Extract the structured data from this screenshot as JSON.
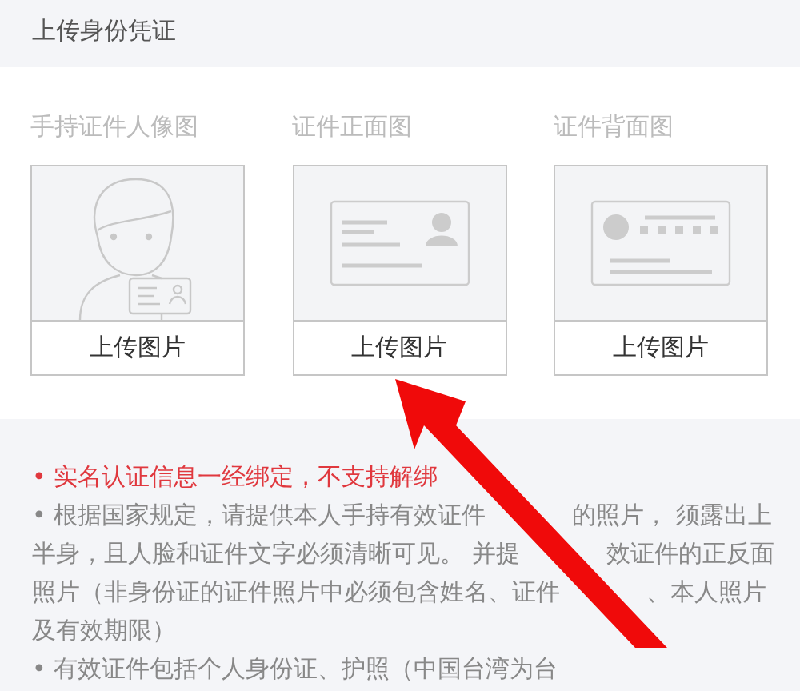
{
  "header": {
    "title": "上传身份凭证"
  },
  "uploads": [
    {
      "kind": "portrait",
      "label": "手持证件人像图",
      "button": "上传图片"
    },
    {
      "kind": "front",
      "label": "证件正面图",
      "button": "上传图片"
    },
    {
      "kind": "back",
      "label": "证件背面图",
      "button": "上传图片"
    }
  ],
  "notes": [
    {
      "kind": "warning",
      "segments": [
        "• 实名认证信息一经绑定，不支持解绑"
      ]
    },
    {
      "kind": "normal",
      "segments": [
        "• 根据国家规定，请提供本人手持有效证件",
        "的照片， 须露出上"
      ]
    },
    {
      "kind": "normal",
      "segments": [
        "半身，且人脸和证件文字必须清晰可见。 并提",
        "效证件的正反面"
      ]
    },
    {
      "kind": "normal",
      "segments": [
        "照片（非身份证的证件照片中必须包含姓名、证件",
        "、本人照片"
      ]
    },
    {
      "kind": "normal",
      "segments": [
        "及有效期限）"
      ]
    },
    {
      "kind": "normal",
      "segments": [
        "• 有效证件包括个人身份证、护照（中国台湾为台"
      ]
    }
  ]
}
